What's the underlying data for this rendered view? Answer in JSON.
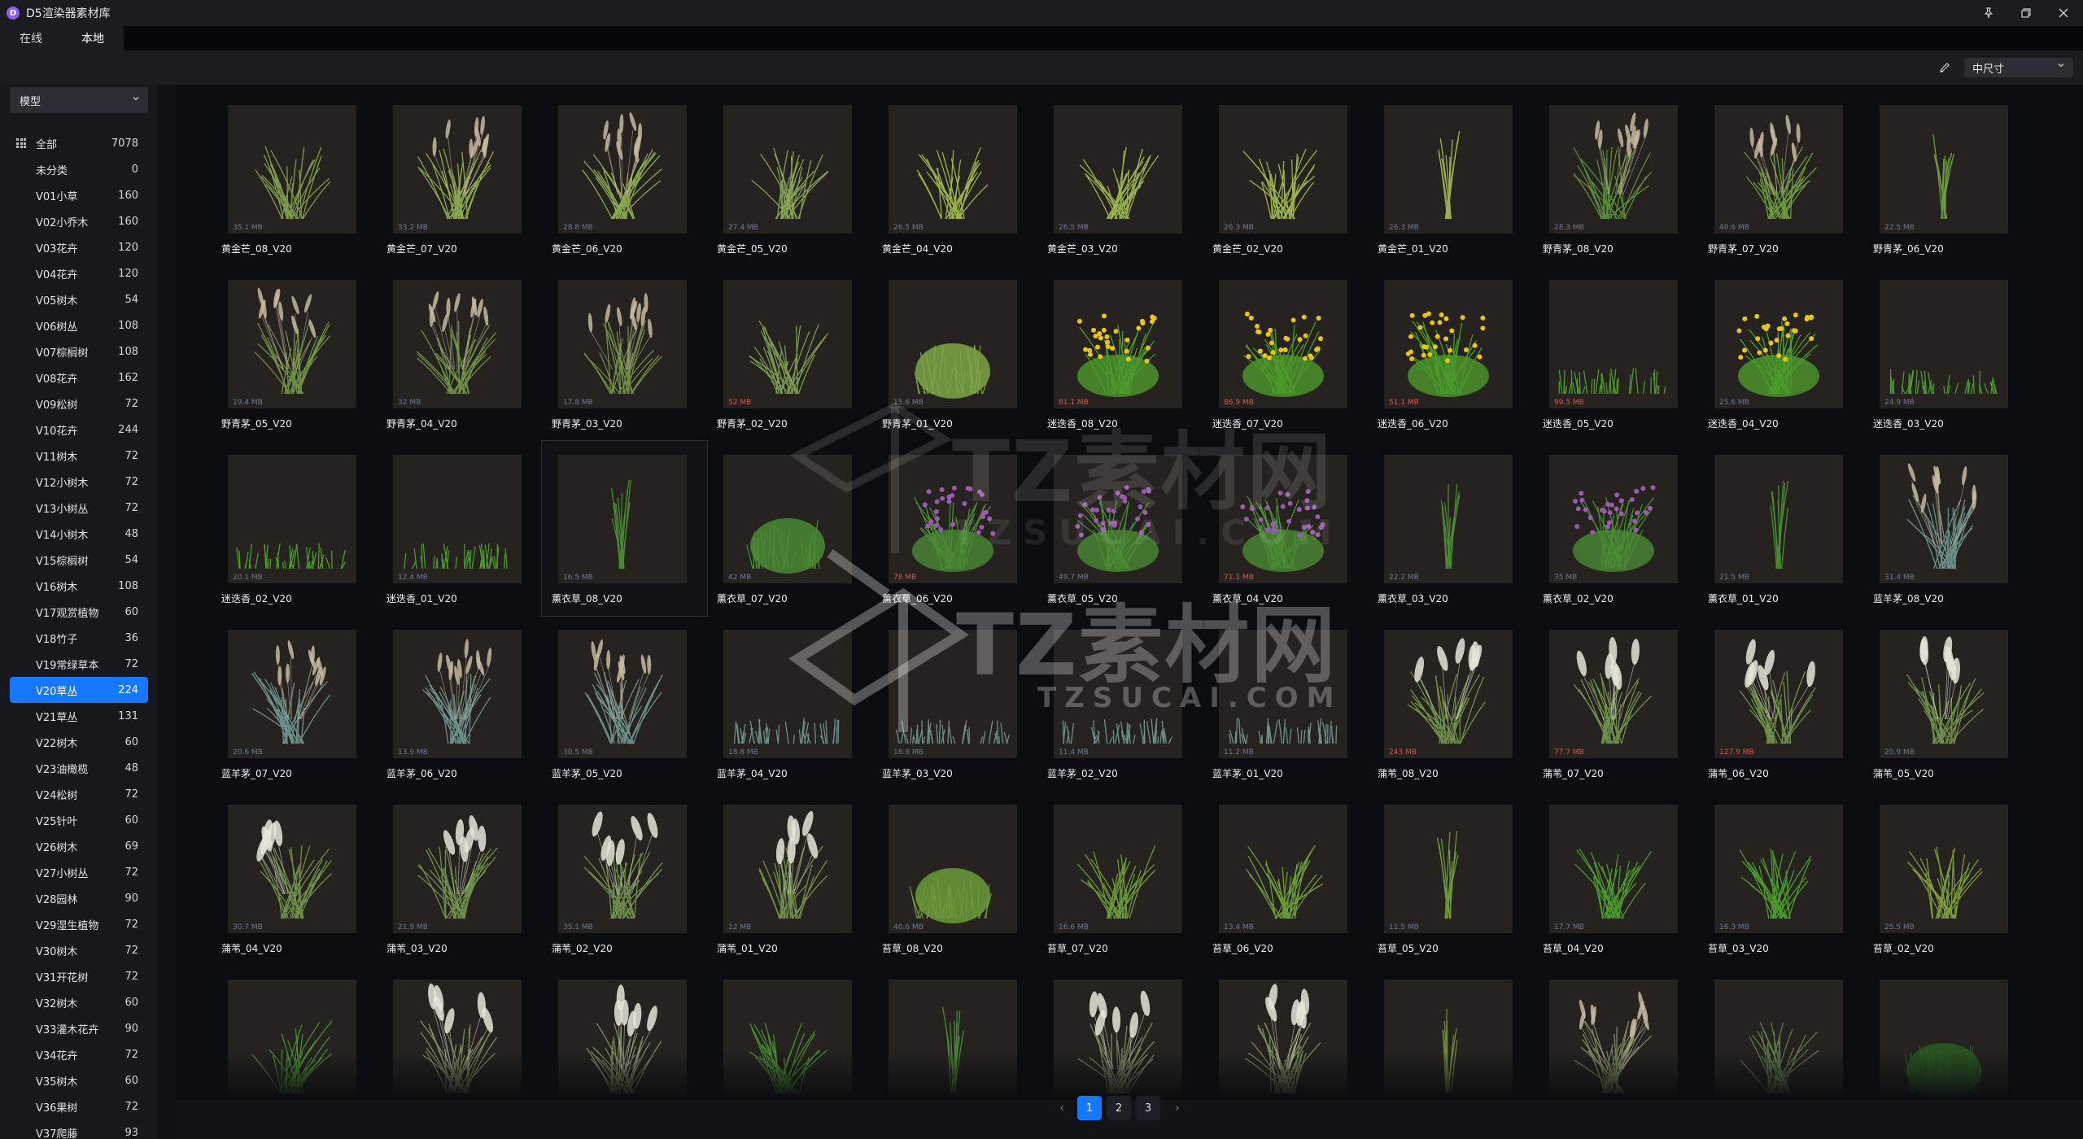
{
  "app": {
    "title": "D5渲染器素材库",
    "logo_letter": "D"
  },
  "window_controls": [
    "pin-icon",
    "restore-icon",
    "close-icon"
  ],
  "tabs": [
    {
      "label": "在线",
      "active": false
    },
    {
      "label": "本地",
      "active": true
    }
  ],
  "toolbar": {
    "size_select": "中尺寸"
  },
  "sidebar": {
    "category_select": "模型",
    "items": [
      {
        "label": "全部",
        "count": "7078"
      },
      {
        "label": "未分类",
        "count": "0"
      },
      {
        "label": "V01小草",
        "count": "160"
      },
      {
        "label": "V02小乔木",
        "count": "160"
      },
      {
        "label": "V03花卉",
        "count": "120"
      },
      {
        "label": "V04花卉",
        "count": "120"
      },
      {
        "label": "V05树木",
        "count": "54"
      },
      {
        "label": "V06树丛",
        "count": "108"
      },
      {
        "label": "V07棕榈树",
        "count": "108"
      },
      {
        "label": "V08花卉",
        "count": "162"
      },
      {
        "label": "V09松树",
        "count": "72"
      },
      {
        "label": "V10花卉",
        "count": "244"
      },
      {
        "label": "V11树木",
        "count": "72"
      },
      {
        "label": "V12小树木",
        "count": "72"
      },
      {
        "label": "V13小树丛",
        "count": "72"
      },
      {
        "label": "V14小树木",
        "count": "48"
      },
      {
        "label": "V15棕榈树",
        "count": "54"
      },
      {
        "label": "V16树木",
        "count": "108"
      },
      {
        "label": "V17观赏植物",
        "count": "60"
      },
      {
        "label": "V18竹子",
        "count": "36"
      },
      {
        "label": "V19常绿草本",
        "count": "72"
      },
      {
        "label": "V20草丛",
        "count": "224",
        "active": true
      },
      {
        "label": "V21草丛",
        "count": "131"
      },
      {
        "label": "V22树木",
        "count": "60"
      },
      {
        "label": "V23油橄榄",
        "count": "48"
      },
      {
        "label": "V24松树",
        "count": "72"
      },
      {
        "label": "V25针叶",
        "count": "60"
      },
      {
        "label": "V26树木",
        "count": "69"
      },
      {
        "label": "V27小树丛",
        "count": "72"
      },
      {
        "label": "V28园林",
        "count": "90"
      },
      {
        "label": "V29湿生植物",
        "count": "72"
      },
      {
        "label": "V30树木",
        "count": "72"
      },
      {
        "label": "V31开花树",
        "count": "72"
      },
      {
        "label": "V32树木",
        "count": "60"
      },
      {
        "label": "V33灌木花卉",
        "count": "90"
      },
      {
        "label": "V34花卉",
        "count": "72"
      },
      {
        "label": "V35树木",
        "count": "60"
      },
      {
        "label": "V36果树",
        "count": "72"
      },
      {
        "label": "V37爬藤",
        "count": "93"
      }
    ]
  },
  "assets": [
    {
      "name": "黄金芒_08_V20",
      "size": "35.1 MB",
      "kind": "grass",
      "color": "#7e9a4c"
    },
    {
      "name": "黄金芒_07_V20",
      "size": "33.2 MB",
      "kind": "plume",
      "color": "#8aa851"
    },
    {
      "name": "黄金芒_06_V20",
      "size": "28.8 MB",
      "kind": "plume",
      "color": "#8aa851"
    },
    {
      "name": "黄金芒_05_V20",
      "size": "27.4 MB",
      "kind": "grass",
      "color": "#86a256"
    },
    {
      "name": "黄金芒_04_V20",
      "size": "26.5 MB",
      "kind": "grass",
      "color": "#9ab34e"
    },
    {
      "name": "黄金芒_03_V20",
      "size": "26.5 MB",
      "kind": "grass",
      "color": "#9ab34e"
    },
    {
      "name": "黄金芒_02_V20",
      "size": "26.3 MB",
      "kind": "grass",
      "color": "#9ab34e"
    },
    {
      "name": "黄金芒_01_V20",
      "size": "26.3 MB",
      "kind": "sprig",
      "color": "#9ab34e"
    },
    {
      "name": "野青茅_08_V20",
      "size": "28.3 MB",
      "kind": "plume",
      "color": "#5c8a3c"
    },
    {
      "name": "野青茅_07_V20",
      "size": "40.6 MB",
      "kind": "plume",
      "color": "#6c9b3e"
    },
    {
      "name": "野青茅_06_V20",
      "size": "22.5 MB",
      "kind": "sprig",
      "color": "#6c9b3e"
    },
    {
      "name": "野青茅_05_V20",
      "size": "19.4 MB",
      "kind": "plume",
      "color": "#6d8f44"
    },
    {
      "name": "野青茅_04_V20",
      "size": "32 MB",
      "kind": "plume",
      "color": "#6d8f44"
    },
    {
      "name": "野青茅_03_V20",
      "size": "17.8 MB",
      "kind": "plume",
      "color": "#6d8f44"
    },
    {
      "name": "野青茅_02_V20",
      "size": "52 MB",
      "kind": "grass",
      "color": "#7a9a52",
      "red": true
    },
    {
      "name": "野青茅_01_V20",
      "size": "15.6 MB",
      "kind": "mound",
      "color": "#7ca447"
    },
    {
      "name": "迷迭香_08_V20",
      "size": "81.1 MB",
      "kind": "flower",
      "color": "#4c9a2c",
      "flower": "#e8c518",
      "red": true
    },
    {
      "name": "迷迭香_07_V20",
      "size": "86.9 MB",
      "kind": "flower",
      "color": "#4c9a2c",
      "flower": "#e8c518",
      "red": true
    },
    {
      "name": "迷迭香_06_V20",
      "size": "51.1 MB",
      "kind": "flower",
      "color": "#4c9a2c",
      "flower": "#e8c518",
      "red": true
    },
    {
      "name": "迷迭香_05_V20",
      "size": "99.5 MB",
      "kind": "low",
      "color": "#4c9a2c",
      "red": true
    },
    {
      "name": "迷迭香_04_V20",
      "size": "25.6 MB",
      "kind": "flower",
      "color": "#4c9a2c",
      "flower": "#e8c518"
    },
    {
      "name": "迷迭香_03_V20",
      "size": "24.9 MB",
      "kind": "low",
      "color": "#4c9a2c"
    },
    {
      "name": "迷迭香_02_V20",
      "size": "20.1 MB",
      "kind": "low",
      "color": "#4c9a2c"
    },
    {
      "name": "迷迭香_01_V20",
      "size": "12.4 MB",
      "kind": "low",
      "color": "#4c9a2c"
    },
    {
      "name": "薰衣草_08_V20",
      "size": "16.5 MB",
      "kind": "sprig",
      "color": "#4a8a34"
    },
    {
      "name": "薰衣草_07_V20",
      "size": "42 MB",
      "kind": "mound",
      "color": "#4a8a34"
    },
    {
      "name": "薰衣草_06_V20",
      "size": "78 MB",
      "kind": "flower",
      "color": "#4a8a34",
      "flower": "#9a5ab0",
      "red": true
    },
    {
      "name": "薰衣草_05_V20",
      "size": "49.7 MB",
      "kind": "flower",
      "color": "#4a8a34",
      "flower": "#9a5ab0"
    },
    {
      "name": "薰衣草_04_V20",
      "size": "71.1 MB",
      "kind": "flower",
      "color": "#4a8a34",
      "flower": "#9a5ab0",
      "red": true
    },
    {
      "name": "薰衣草_03_V20",
      "size": "22.2 MB",
      "kind": "sprig",
      "color": "#4a8a34"
    },
    {
      "name": "薰衣草_02_V20",
      "size": "35 MB",
      "kind": "flower",
      "color": "#4a8a34",
      "flower": "#9a5ab0"
    },
    {
      "name": "薰衣草_01_V20",
      "size": "21.5 MB",
      "kind": "sprig",
      "color": "#4a8a34"
    },
    {
      "name": "蓝羊茅_08_V20",
      "size": "31.4 MB",
      "kind": "plume",
      "color": "#6d8f8a"
    },
    {
      "name": "蓝羊茅_07_V20",
      "size": "20.6 MB",
      "kind": "plume",
      "color": "#6d8f8a"
    },
    {
      "name": "蓝羊茅_06_V20",
      "size": "13.9 MB",
      "kind": "plume",
      "color": "#6d8f8a"
    },
    {
      "name": "蓝羊茅_05_V20",
      "size": "30.5 MB",
      "kind": "plume",
      "color": "#6d8f8a"
    },
    {
      "name": "蓝羊茅_04_V20",
      "size": "18.8 MB",
      "kind": "low",
      "color": "#6d8f8a"
    },
    {
      "name": "蓝羊茅_03_V20",
      "size": "18.8 MB",
      "kind": "low",
      "color": "#6d8f8a"
    },
    {
      "name": "蓝羊茅_02_V20",
      "size": "11.4 MB",
      "kind": "low",
      "color": "#6d8f8a"
    },
    {
      "name": "蓝羊茅_01_V20",
      "size": "11.2 MB",
      "kind": "low",
      "color": "#6d8f8a"
    },
    {
      "name": "蒲苇_08_V20",
      "size": "243 MB",
      "kind": "pampas",
      "color": "#6f8f4c",
      "red": true
    },
    {
      "name": "蒲苇_07_V20",
      "size": "77.7 MB",
      "kind": "pampas",
      "color": "#6f8f4c",
      "red": true
    },
    {
      "name": "蒲苇_06_V20",
      "size": "127.9 MB",
      "kind": "pampas",
      "color": "#6f8f4c",
      "red": true
    },
    {
      "name": "蒲苇_05_V20",
      "size": "20.9 MB",
      "kind": "pampas",
      "color": "#6f8f4c"
    },
    {
      "name": "蒲苇_04_V20",
      "size": "30.7 MB",
      "kind": "pampas",
      "color": "#6f8f4c"
    },
    {
      "name": "蒲苇_03_V20",
      "size": "21.9 MB",
      "kind": "pampas",
      "color": "#6f8f4c"
    },
    {
      "name": "蒲苇_02_V20",
      "size": "35.1 MB",
      "kind": "pampas",
      "color": "#6f8f4c"
    },
    {
      "name": "蒲苇_01_V20",
      "size": "12 MB",
      "kind": "pampas",
      "color": "#6f8f4c"
    },
    {
      "name": "苔草_08_V20",
      "size": "40.6 MB",
      "kind": "mound",
      "color": "#6c9a3a"
    },
    {
      "name": "苔草_07_V20",
      "size": "16.6 MB",
      "kind": "grass",
      "color": "#6c9a3a"
    },
    {
      "name": "苔草_06_V20",
      "size": "13.4 MB",
      "kind": "grass",
      "color": "#6c9a3a"
    },
    {
      "name": "苔草_05_V20",
      "size": "11.5 MB",
      "kind": "sprig",
      "color": "#6c9a3a"
    },
    {
      "name": "苔草_04_V20",
      "size": "17.7 MB",
      "kind": "grass",
      "color": "#4c9a2c"
    },
    {
      "name": "苔草_03_V20",
      "size": "16.3 MB",
      "kind": "grass",
      "color": "#4c9a2c"
    },
    {
      "name": "苔草_02_V20",
      "size": "25.5 MB",
      "kind": "grass",
      "color": "#7a9a3c"
    },
    {
      "name": "",
      "size": "",
      "kind": "grass",
      "color": "#4a8a34"
    },
    {
      "name": "",
      "size": "",
      "kind": "pampas",
      "color": "#7a8a5c"
    },
    {
      "name": "",
      "size": "",
      "kind": "pampas",
      "color": "#7a8a5c"
    },
    {
      "name": "",
      "size": "",
      "kind": "grass",
      "color": "#4a8a34"
    },
    {
      "name": "",
      "size": "",
      "kind": "sprig",
      "color": "#4a8a34"
    },
    {
      "name": "",
      "size": "",
      "kind": "pampas",
      "color": "#7a8a5c"
    },
    {
      "name": "",
      "size": "",
      "kind": "pampas",
      "color": "#7a8a5c"
    },
    {
      "name": "",
      "size": "",
      "kind": "sprig",
      "color": "#6c8a3c"
    },
    {
      "name": "",
      "size": "",
      "kind": "plume",
      "color": "#7a8a5c"
    },
    {
      "name": "",
      "size": "",
      "kind": "grass",
      "color": "#5c7a4c"
    },
    {
      "name": "",
      "size": "",
      "kind": "mound",
      "color": "#2c5a24"
    }
  ],
  "pagination": {
    "prev": "‹",
    "next": "›",
    "pages": [
      "1",
      "2",
      "3"
    ],
    "current": "1"
  },
  "watermark": {
    "text": "TZ素材网",
    "sub": "TZSUCAI.COM"
  }
}
